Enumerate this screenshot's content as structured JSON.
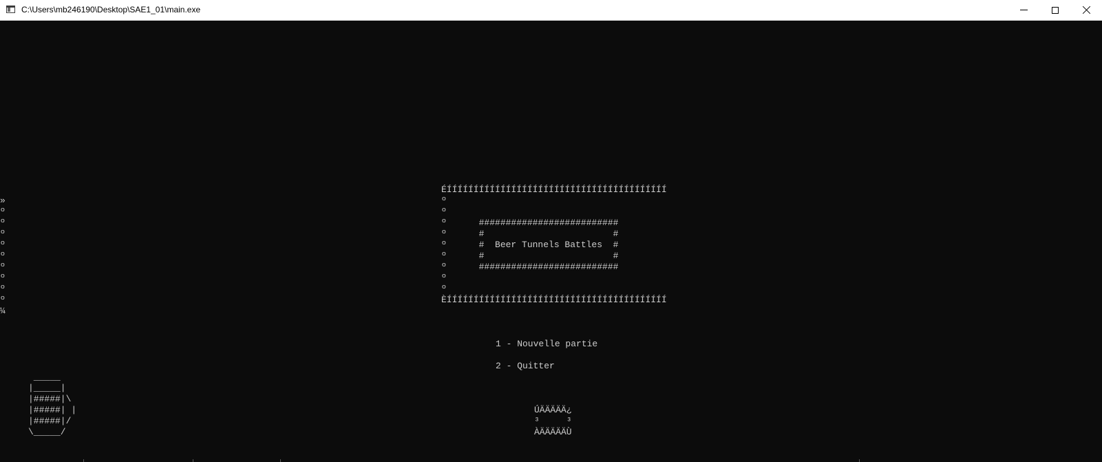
{
  "window": {
    "title": "C:\\Users\\mb246190\\Desktop\\SAE1_01\\main.exe",
    "icon": "console-app-icon",
    "controls": {
      "minimize": "minimize-icon",
      "maximize": "maximize-icon",
      "close": "close-icon"
    }
  },
  "console": {
    "background": "#0c0c0c",
    "foreground": "#cccccc",
    "title_frame": "ÉÍÍÍÍÍÍÍÍÍÍÍÍÍÍÍÍÍÍÍÍÍÍÍÍÍÍÍÍÍÍÍÍÍÍÍÍÍÍÍÍÍ\nº\nº\nº      ##########################\nº      #                        #\nº      #  Beer Tunnels Battles  #\nº      #                        #\nº      ##########################\nº\nº\nÈÍÍÍÍÍÍÍÍÍÍÍÍÍÍÍÍÍÍÍÍÍÍÍÍÍÍÍÍÍÍÍÍÍÍÍÍÍÍÍÍÍ",
    "left_border": "»\nº\nº\nº\nº\nº\nº\nº\nº\nº\n¼",
    "menu": [
      "1 - Nouvelle partie",
      "2 - Quitter"
    ],
    "beer_art": " _____\n|_____|\n|#####|\\\n|#####| |\n|#####|/\n\\_____/",
    "input_box": "ÚÄÄÄÄÄ¿\n³     ³\nÀÄÄÄÄÄÙ"
  }
}
